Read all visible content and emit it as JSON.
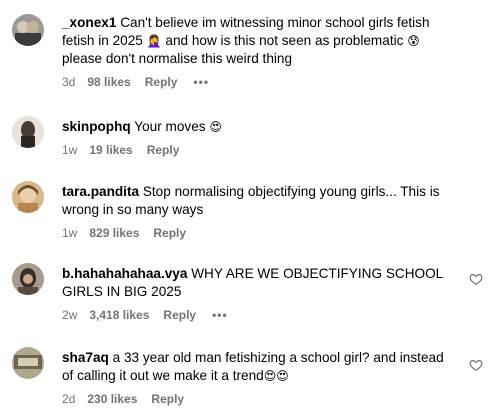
{
  "comments": [
    {
      "username": "_xonex1",
      "text_before": "Can't believe im witnessing minor school girls fetish fetish in 2025",
      "emoji_1": "🤦‍♀️",
      "text_middle": " and how is this not seen as problematic ",
      "emoji_2": "😰",
      "text_after": " please don't normalise this weird thing",
      "time": "3d",
      "likes": "98 likes",
      "reply": "Reply",
      "more": "•••",
      "avatar_color": "#8a8a8a"
    },
    {
      "username": "skinpophq",
      "text": "Your moves",
      "emoji": "😍",
      "time": "1w",
      "likes": "19 likes",
      "reply": "Reply",
      "avatar_color": "#6b5a52"
    },
    {
      "username": "tara.pandita",
      "text": "Stop normalising objectifying young girls... This is wrong in so many ways",
      "time": "1w",
      "likes": "829 likes",
      "reply": "Reply",
      "avatar_color": "#c9a36f"
    },
    {
      "username": "b.hahahahahaa.vya",
      "text": "WHY ARE WE OBJECTIFYING SCHOOL GIRLS IN BIG 2025",
      "time": "2w",
      "likes": "3,418 likes",
      "reply": "Reply",
      "more": "•••",
      "avatar_color": "#7a6a60"
    },
    {
      "username": "sha7aq",
      "text": "a 33 year old man fetishizing a school girl? and instead of calling it out we make it a trend",
      "emoji": "😍😍",
      "time": "2d",
      "likes": "230 likes",
      "reply": "Reply",
      "avatar_color": "#8d8470"
    }
  ],
  "colors": {
    "meta_text": "#737373",
    "heart_outline": "#737373"
  },
  "icons": {
    "heart": "heart-outline-icon",
    "more": "more-options-icon"
  }
}
